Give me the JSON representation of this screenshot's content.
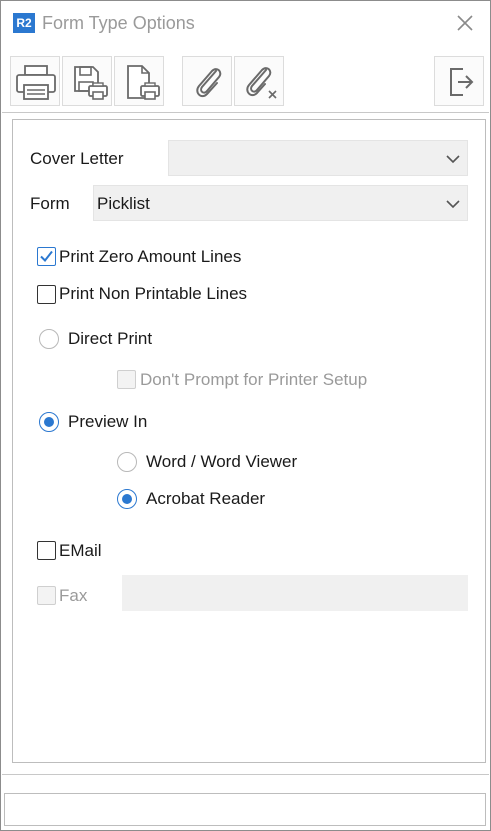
{
  "window": {
    "app_badge": "R2",
    "title": "Form Type Options"
  },
  "toolbar": {
    "buttons": [
      {
        "name": "print",
        "icon": "printer-icon"
      },
      {
        "name": "save-print",
        "icon": "save-printer-icon"
      },
      {
        "name": "document-print",
        "icon": "document-printer-icon"
      },
      {
        "name": "attach",
        "icon": "paperclip-icon"
      },
      {
        "name": "remove-attachment",
        "icon": "paperclip-remove-icon"
      },
      {
        "name": "exit",
        "icon": "exit-icon"
      }
    ]
  },
  "form": {
    "cover_letter_label": "Cover Letter",
    "cover_letter_value": "",
    "form_label": "Form",
    "form_value": "Picklist",
    "print_zero_amount_lines": {
      "label": "Print Zero Amount Lines",
      "checked": true
    },
    "print_non_printable_lines": {
      "label": "Print Non Printable Lines",
      "checked": false
    },
    "direct_print": {
      "label": "Direct Print",
      "selected": false
    },
    "dont_prompt": {
      "label": "Don't Prompt for Printer Setup",
      "checked": false,
      "disabled": true
    },
    "preview_in": {
      "label": "Preview In",
      "selected": true
    },
    "word_viewer": {
      "label": "Word / Word Viewer",
      "selected": false
    },
    "acrobat_reader": {
      "label": "Acrobat Reader",
      "selected": true
    },
    "email": {
      "label": "EMail",
      "checked": false
    },
    "fax": {
      "label": "Fax",
      "checked": false,
      "disabled": true,
      "value": ""
    }
  },
  "status_bar": {
    "text": ""
  },
  "colors": {
    "accent": "#2b78d0",
    "disabled_text": "#9a9a9a",
    "field_bg": "#f0f0f0"
  }
}
